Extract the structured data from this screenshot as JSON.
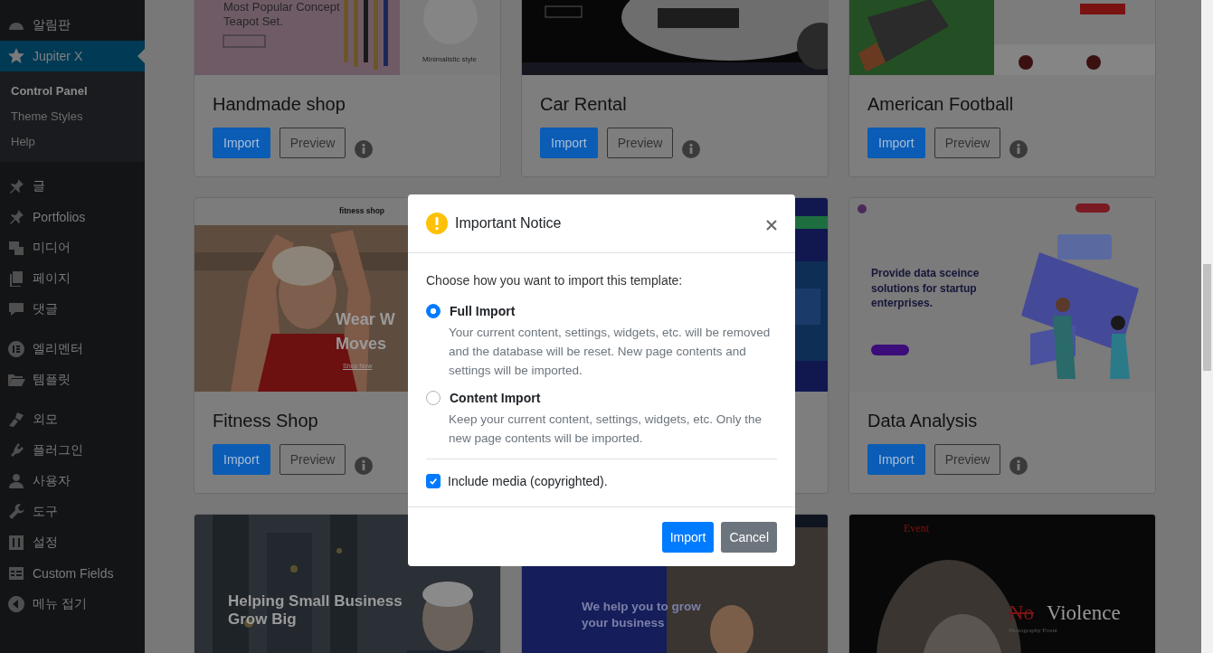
{
  "sidebar": {
    "sections": [
      [
        {
          "label": "알림판",
          "selected": false
        },
        {
          "label": "Jupiter X",
          "selected": true,
          "children": [
            {
              "label": "Control Panel",
              "selected": true
            },
            {
              "label": "Theme Styles",
              "selected": false
            },
            {
              "label": "Help",
              "selected": false
            }
          ]
        }
      ],
      [
        {
          "label": "글",
          "selected": false
        },
        {
          "label": "Portfolios",
          "selected": false
        },
        {
          "label": "미디어",
          "selected": false
        },
        {
          "label": "페이지",
          "selected": false
        },
        {
          "label": "댓글",
          "selected": false
        }
      ],
      [
        {
          "label": "엘리멘터",
          "selected": false
        },
        {
          "label": "템플릿",
          "selected": false
        }
      ],
      [
        {
          "label": "외모",
          "selected": false
        },
        {
          "label": "플러그인",
          "selected": false
        },
        {
          "label": "사용자",
          "selected": false
        },
        {
          "label": "도구",
          "selected": false
        },
        {
          "label": "설정",
          "selected": false
        },
        {
          "label": "Custom Fields",
          "selected": false
        },
        {
          "label": "메뉴 접기",
          "selected": false
        }
      ]
    ]
  },
  "templates": [
    {
      "kind": "full",
      "title": "Handmade shop",
      "buttons": [
        "Import",
        "Preview"
      ],
      "thumb_texts": [
        "Most Popular Concept",
        "Teapot Set.",
        "Minimalistic style"
      ]
    },
    {
      "kind": "full",
      "title": "Car Rental",
      "buttons": [
        "Import",
        "Preview"
      ]
    },
    {
      "kind": "full",
      "title": "American Football",
      "buttons": [
        "Import",
        "Preview"
      ]
    },
    {
      "kind": "full",
      "title": "Fitness Shop",
      "buttons": [
        "Import",
        "Preview"
      ],
      "thumb_texts": [
        "fitness shop",
        "Wear W",
        "Moves",
        "Shop Now"
      ]
    },
    {
      "kind": "picture"
    },
    {
      "kind": "full",
      "title": "Data Analysis",
      "buttons": [
        "Import",
        "Preview"
      ],
      "thumb_texts": [
        "Provide data sceince solutions for startup enterprises."
      ]
    },
    {
      "kind": "picture",
      "thumb_texts": [
        "Helping Small Business Grow Big"
      ]
    },
    {
      "kind": "picture",
      "thumb_texts": [
        "We help you to grow your business"
      ]
    },
    {
      "kind": "picture",
      "thumb_texts": [
        "Event",
        "No",
        "Violence",
        "Photography Event"
      ]
    }
  ],
  "modal": {
    "title": "Important Notice",
    "intro": "Choose how you want to import this template:",
    "options": [
      {
        "label": "Full Import",
        "description": "Your current content, settings, widgets, etc. will be removed and the database will be reset. New page contents and settings will be imported.",
        "selected": true
      },
      {
        "label": "Content Import",
        "description": "Keep your current content, settings, widgets, etc. Only the new page contents will be imported.",
        "selected": false
      }
    ],
    "include_media": {
      "label": "Include media (copyrighted).",
      "checked": true
    },
    "buttons": [
      "Import",
      "Cancel"
    ]
  }
}
